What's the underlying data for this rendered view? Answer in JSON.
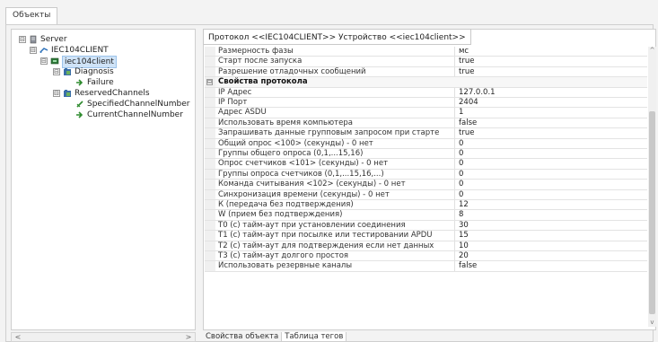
{
  "window": {
    "top_tab": "Объекты"
  },
  "tree": {
    "items": [
      {
        "label": "Server",
        "icon": "server-icon",
        "expander": "⊟",
        "selected": false
      },
      {
        "label": "IEC104CLIENT",
        "icon": "link-icon",
        "expander": "⊟",
        "selected": false
      },
      {
        "label": "iec104client",
        "icon": "device-icon",
        "expander": "⊟",
        "selected": true
      },
      {
        "label": "Diagnosis",
        "icon": "folder-icon",
        "expander": "⊟",
        "selected": false
      },
      {
        "label": "Failure",
        "icon": "arrow-icon",
        "expander": "",
        "selected": false
      },
      {
        "label": "ReservedChannels",
        "icon": "folder-icon",
        "expander": "⊟",
        "selected": false
      },
      {
        "label": "SpecifiedChannelNumber",
        "icon": "edit-icon",
        "expander": "",
        "selected": false
      },
      {
        "label": "CurrentChannelNumber",
        "icon": "arrow-icon",
        "expander": "",
        "selected": false
      }
    ]
  },
  "doc_tab": {
    "label": "Протокол <<IEC104CLIENT>> Устройство <<iec104client>>"
  },
  "properties": {
    "rows": [
      {
        "name": "Размерность фазы",
        "value": "мс"
      },
      {
        "name": "Старт после запуска",
        "value": "true"
      },
      {
        "name": "Разрешение отладочных сообщений",
        "value": "true"
      },
      {
        "category": true,
        "name": "Свойства протокола",
        "expander": "⊟"
      },
      {
        "name": "IP Адрес",
        "value": "127.0.0.1"
      },
      {
        "name": "IP Порт",
        "value": "2404"
      },
      {
        "name": "Адрес ASDU",
        "value": "1"
      },
      {
        "name": "Использовать время компьютера",
        "value": "false"
      },
      {
        "name": "Запрашивать данные групповым запросом при старте",
        "value": "true"
      },
      {
        "name": "Общий опрос <100> (секунды) - 0 нет",
        "value": "0"
      },
      {
        "name": "Группы общего опроса (0,1,...15,16)",
        "value": "0"
      },
      {
        "name": "Опрос счетчиков <101> (секунды) - 0 нет",
        "value": "0"
      },
      {
        "name": "Группы опроса счетчиков (0,1,...15,16,...)",
        "value": "0"
      },
      {
        "name": "Команда считывания <102> (секунды) - 0 нет",
        "value": "0"
      },
      {
        "name": "Синхронизация времени (секунды) - 0 нет",
        "value": "0"
      },
      {
        "name": "К (передача без подтверждения)",
        "value": "12"
      },
      {
        "name": "W (прием без подтверждения)",
        "value": "8"
      },
      {
        "name": "T0 (с) тайм-аут при установлении соединения",
        "value": "30"
      },
      {
        "name": "T1 (с) тайм-аут при посылке или тестировании APDU",
        "value": "15"
      },
      {
        "name": "T2 (с) тайм-аут для подтверждения если нет данных",
        "value": "10"
      },
      {
        "name": "T3 (с) тайм-аут долгого простоя",
        "value": "20"
      },
      {
        "name": "Использовать резервные каналы",
        "value": "false"
      }
    ]
  },
  "bottom_tabs": [
    {
      "label": "Свойства объекта",
      "active": false
    },
    {
      "label": "Таблица тегов",
      "active": true
    }
  ],
  "scroll": {
    "left_arrow": "<",
    "right_arrow": ">",
    "up_arrow": "^",
    "down_arrow": "v"
  }
}
